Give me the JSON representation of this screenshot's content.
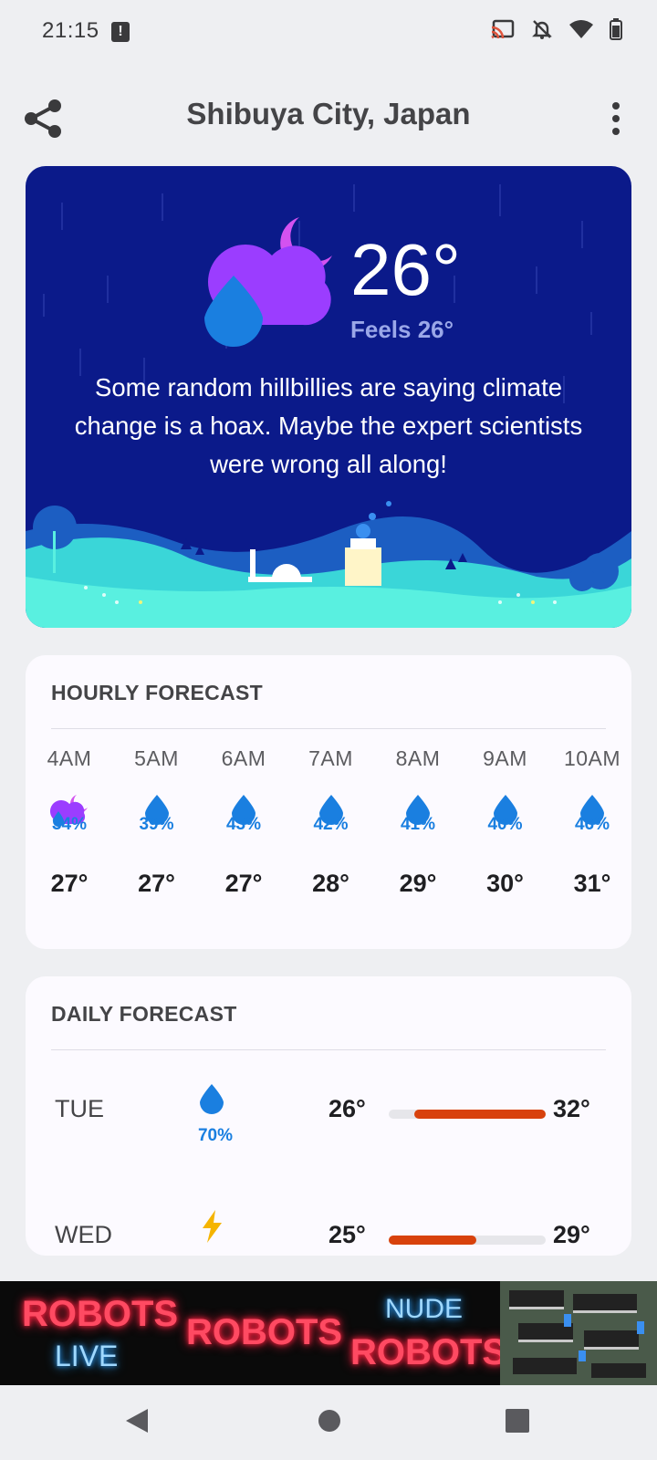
{
  "status_bar": {
    "time": "21:15"
  },
  "header": {
    "title": "Shibuya City, Japan"
  },
  "current": {
    "temperature": "26°",
    "feels_like": "Feels 26°",
    "message": "Some random hillbillies are saying climate change is a hoax. Maybe the expert scientists were wrong all along!"
  },
  "hourly": {
    "title": "HOURLY FORECAST",
    "items": [
      {
        "time": "4AM",
        "icon": "cloudy-night-rain-icon",
        "precip": "34%",
        "temp": "27°"
      },
      {
        "time": "5AM",
        "icon": "raindrop-icon",
        "precip": "39%",
        "temp": "27°"
      },
      {
        "time": "6AM",
        "icon": "raindrop-icon",
        "precip": "43%",
        "temp": "27°"
      },
      {
        "time": "7AM",
        "icon": "raindrop-icon",
        "precip": "42%",
        "temp": "28°"
      },
      {
        "time": "8AM",
        "icon": "raindrop-icon",
        "precip": "41%",
        "temp": "29°"
      },
      {
        "time": "9AM",
        "icon": "raindrop-icon",
        "precip": "40%",
        "temp": "30°"
      },
      {
        "time": "10AM",
        "icon": "raindrop-icon",
        "precip": "46%",
        "temp": "31°"
      }
    ]
  },
  "daily": {
    "title": "DAILY FORECAST",
    "items": [
      {
        "day": "TUE",
        "icon": "raindrop-icon",
        "precip": "70%",
        "low": "26°",
        "high": "32°",
        "range_start": 0.16,
        "range_end": 1.0
      },
      {
        "day": "WED",
        "icon": "lightning-icon",
        "precip": "",
        "low": "25°",
        "high": "29°",
        "range_start": 0.0,
        "range_end": 0.56
      }
    ]
  },
  "ad": {
    "words": [
      "ROBOTS",
      "LIVE",
      "ROBOTS",
      "NUDE",
      "ROBOTS"
    ]
  },
  "colors": {
    "hero_bg": "#0b1a8a",
    "precip_blue": "#1a7fe0",
    "temp_bar": "#d8420c",
    "icon_purple": "#9b3dff"
  }
}
